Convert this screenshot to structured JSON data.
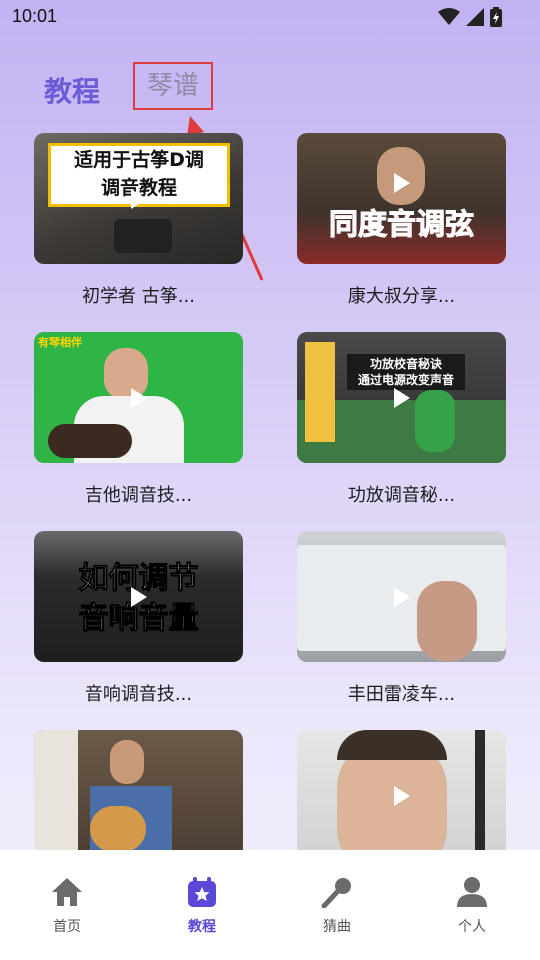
{
  "status": {
    "time": "10:01"
  },
  "tabs": {
    "active": "教程",
    "secondary": "琴谱"
  },
  "cards": [
    {
      "title": "初学者 古筝...",
      "overlay": [
        "适用于古筝D调",
        "调音教程"
      ]
    },
    {
      "title": "康大叔分享...",
      "overlay": [
        "同度音调弦"
      ]
    },
    {
      "title": "吉他调音技...",
      "overlay": [
        "有琴相伴"
      ]
    },
    {
      "title": "功放调音秘...",
      "overlay": [
        "功放校音秘诀",
        "通过电源改变声音"
      ]
    },
    {
      "title": "音响调音技...",
      "overlay": [
        "如何调节",
        "音响音量"
      ]
    },
    {
      "title": "丰田雷凌车...",
      "overlay": []
    },
    {
      "title": "",
      "overlay": []
    },
    {
      "title": "",
      "overlay": []
    }
  ],
  "nav": [
    {
      "label": "首页",
      "icon": "home-icon"
    },
    {
      "label": "教程",
      "icon": "calendar-star-icon"
    },
    {
      "label": "猜曲",
      "icon": "microphone-icon"
    },
    {
      "label": "个人",
      "icon": "person-icon"
    }
  ],
  "colors": {
    "accent": "#5a48d8",
    "highlight_box": "#e03a3a"
  }
}
